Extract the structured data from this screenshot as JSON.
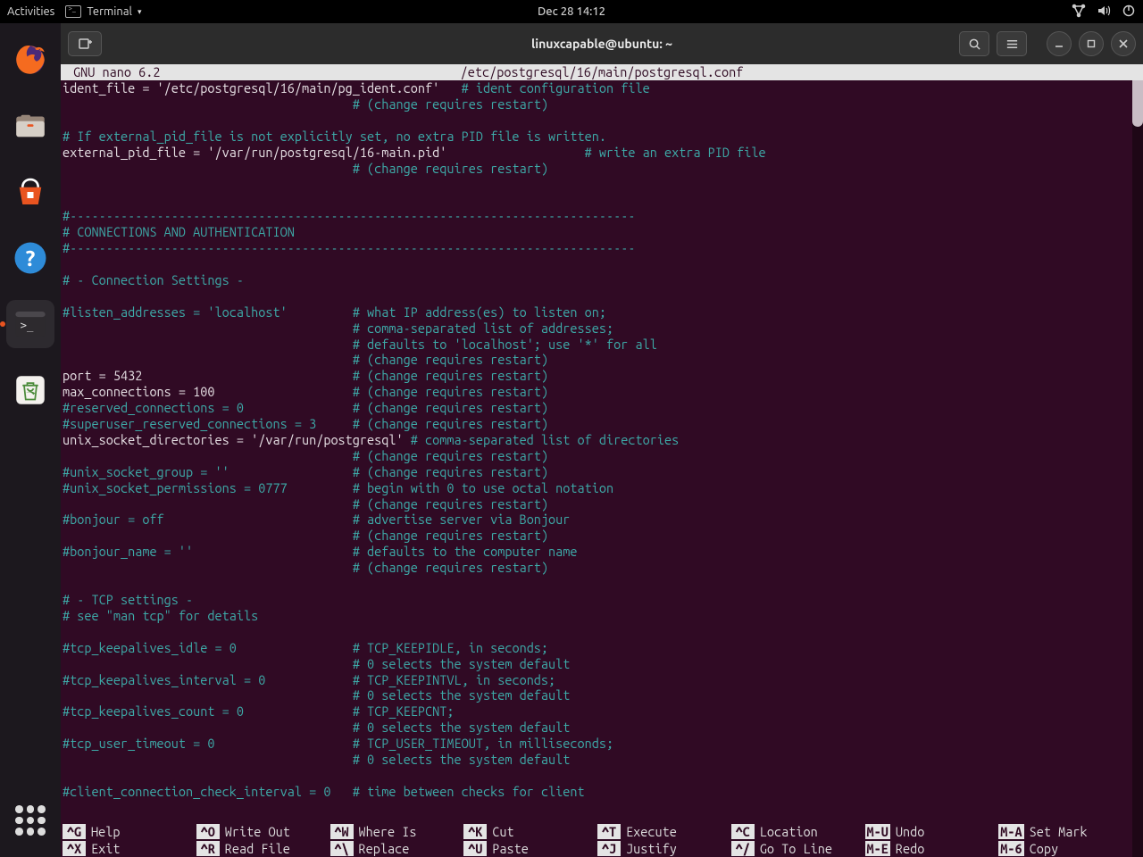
{
  "topbar": {
    "activities": "Activities",
    "app_name": "Terminal",
    "clock": "Dec 28  14:12"
  },
  "dock": {
    "items": [
      "firefox",
      "files",
      "software",
      "help",
      "terminal",
      "trash"
    ],
    "active": "terminal"
  },
  "window": {
    "title": "linuxcapable@ubuntu: ~",
    "buttons": {
      "search": "search",
      "menu": "menu",
      "min": "minimize",
      "max": "maximize",
      "close": "close"
    }
  },
  "nano": {
    "app": "GNU nano  6.2",
    "file": "/etc/postgresql/16/main/postgresql.conf"
  },
  "lines": [
    {
      "t": "setting",
      "pre": "ident_file = '/etc/postgresql/16/main/pg_ident.conf'",
      "pad": "   ",
      "cmt": "# ident configuration file"
    },
    {
      "t": "cmt_pad",
      "pad": "                                        ",
      "cmt": "# (change requires restart)"
    },
    {
      "t": "blank"
    },
    {
      "t": "cmt",
      "cmt": "# If external_pid_file is not explicitly set, no extra PID file is written."
    },
    {
      "t": "setting",
      "pre": "external_pid_file = '/var/run/postgresql/16-main.pid'",
      "pad": "                   ",
      "cmt": "# write an extra PID file"
    },
    {
      "t": "cmt_pad",
      "pad": "                                        ",
      "cmt": "# (change requires restart)"
    },
    {
      "t": "blank"
    },
    {
      "t": "blank"
    },
    {
      "t": "cmt",
      "cmt": "#------------------------------------------------------------------------------"
    },
    {
      "t": "cmt",
      "cmt": "# CONNECTIONS AND AUTHENTICATION"
    },
    {
      "t": "cmt",
      "cmt": "#------------------------------------------------------------------------------"
    },
    {
      "t": "blank"
    },
    {
      "t": "cmt",
      "cmt": "# - Connection Settings -"
    },
    {
      "t": "blank"
    },
    {
      "t": "cmt_inline",
      "pre": "#listen_addresses = 'localhost'",
      "pad": "         ",
      "cmt": "# what IP address(es) to listen on;"
    },
    {
      "t": "cmt_pad",
      "pad": "                                        ",
      "cmt": "# comma-separated list of addresses;"
    },
    {
      "t": "cmt_pad",
      "pad": "                                        ",
      "cmt": "# defaults to 'localhost'; use '*' for all"
    },
    {
      "t": "cmt_pad",
      "pad": "                                        ",
      "cmt": "# (change requires restart)"
    },
    {
      "t": "setting",
      "pre": "port = 5432",
      "pad": "                             ",
      "cmt": "# (change requires restart)"
    },
    {
      "t": "setting",
      "pre": "max_connections = 100",
      "pad": "                   ",
      "cmt": "# (change requires restart)"
    },
    {
      "t": "cmt_inline",
      "pre": "#reserved_connections = 0",
      "pad": "               ",
      "cmt": "# (change requires restart)"
    },
    {
      "t": "cmt_inline",
      "pre": "#superuser_reserved_connections = 3",
      "pad": "     ",
      "cmt": "# (change requires restart)"
    },
    {
      "t": "setting",
      "pre": "unix_socket_directories = '/var/run/postgresql'",
      "pad": " ",
      "cmt": "# comma-separated list of directories"
    },
    {
      "t": "cmt_pad",
      "pad": "                                        ",
      "cmt": "# (change requires restart)"
    },
    {
      "t": "cmt_inline",
      "pre": "#unix_socket_group = ''",
      "pad": "                 ",
      "cmt": "# (change requires restart)"
    },
    {
      "t": "cmt_inline",
      "pre": "#unix_socket_permissions = 0777",
      "pad": "         ",
      "cmt": "# begin with 0 to use octal notation"
    },
    {
      "t": "cmt_pad",
      "pad": "                                        ",
      "cmt": "# (change requires restart)"
    },
    {
      "t": "cmt_inline",
      "pre": "#bonjour = off",
      "pad": "                          ",
      "cmt": "# advertise server via Bonjour"
    },
    {
      "t": "cmt_pad",
      "pad": "                                        ",
      "cmt": "# (change requires restart)"
    },
    {
      "t": "cmt_inline",
      "pre": "#bonjour_name = ''",
      "pad": "                      ",
      "cmt": "# defaults to the computer name"
    },
    {
      "t": "cmt_pad",
      "pad": "                                        ",
      "cmt": "# (change requires restart)"
    },
    {
      "t": "blank"
    },
    {
      "t": "cmt",
      "cmt": "# - TCP settings -"
    },
    {
      "t": "cmt",
      "cmt": "# see \"man tcp\" for details"
    },
    {
      "t": "blank"
    },
    {
      "t": "cmt_inline",
      "pre": "#tcp_keepalives_idle = 0",
      "pad": "                ",
      "cmt": "# TCP_KEEPIDLE, in seconds;"
    },
    {
      "t": "cmt_pad",
      "pad": "                                        ",
      "cmt": "# 0 selects the system default"
    },
    {
      "t": "cmt_inline",
      "pre": "#tcp_keepalives_interval = 0",
      "pad": "            ",
      "cmt": "# TCP_KEEPINTVL, in seconds;"
    },
    {
      "t": "cmt_pad",
      "pad": "                                        ",
      "cmt": "# 0 selects the system default"
    },
    {
      "t": "cmt_inline",
      "pre": "#tcp_keepalives_count = 0",
      "pad": "               ",
      "cmt": "# TCP_KEEPCNT;"
    },
    {
      "t": "cmt_pad",
      "pad": "                                        ",
      "cmt": "# 0 selects the system default"
    },
    {
      "t": "cmt_inline",
      "pre": "#tcp_user_timeout = 0",
      "pad": "                   ",
      "cmt": "# TCP_USER_TIMEOUT, in milliseconds;"
    },
    {
      "t": "cmt_pad",
      "pad": "                                        ",
      "cmt": "# 0 selects the system default"
    },
    {
      "t": "blank"
    },
    {
      "t": "cmt_inline",
      "pre": "#client_connection_check_interval = 0",
      "pad": "   ",
      "cmt": "# time between checks for client"
    }
  ],
  "shortcuts": [
    {
      "key": "^G",
      "label": "Help"
    },
    {
      "key": "^O",
      "label": "Write Out"
    },
    {
      "key": "^W",
      "label": "Where Is"
    },
    {
      "key": "^K",
      "label": "Cut"
    },
    {
      "key": "^T",
      "label": "Execute"
    },
    {
      "key": "^C",
      "label": "Location"
    },
    {
      "key": "M-U",
      "label": "Undo"
    },
    {
      "key": "M-A",
      "label": "Set Mark"
    },
    {
      "key": "^X",
      "label": "Exit"
    },
    {
      "key": "^R",
      "label": "Read File"
    },
    {
      "key": "^\\",
      "label": "Replace"
    },
    {
      "key": "^U",
      "label": "Paste"
    },
    {
      "key": "^J",
      "label": "Justify"
    },
    {
      "key": "^/",
      "label": "Go To Line"
    },
    {
      "key": "M-E",
      "label": "Redo"
    },
    {
      "key": "M-6",
      "label": "Copy"
    }
  ]
}
